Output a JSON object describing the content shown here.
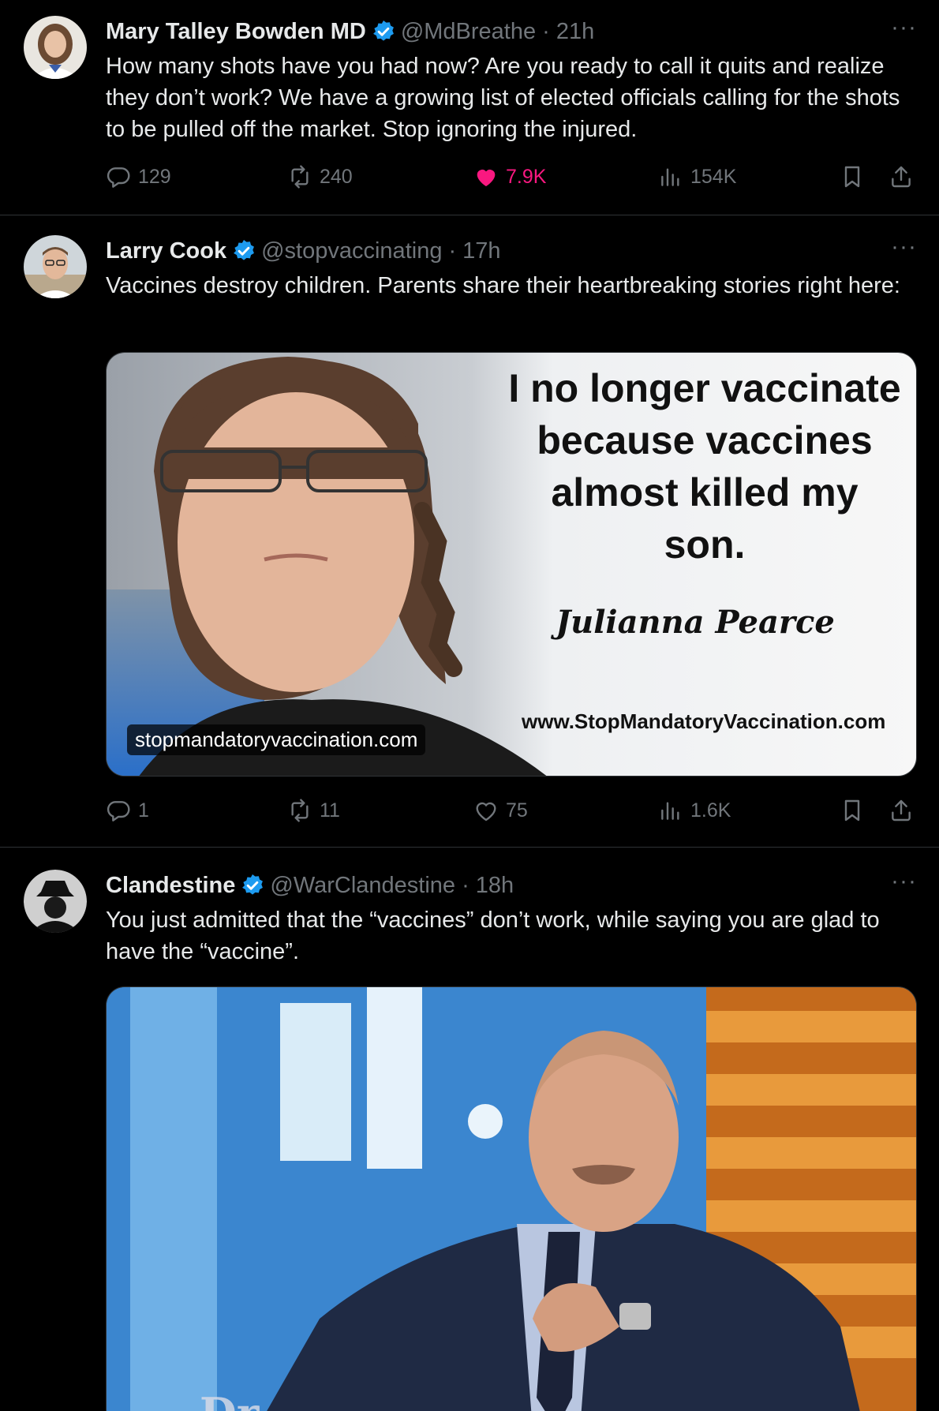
{
  "tweets": [
    {
      "name": "Mary Talley Bowden MD",
      "handle": "@MdBreathe",
      "time": "· 21h",
      "text": "How many shots have you had now?  Are you ready to call it quits and realize they don’t work?  We have a growing list of elected officials calling for the shots to be pulled off the market.  Stop ignoring the injured.",
      "replies": "129",
      "reposts": "240",
      "likes": "7.9K",
      "views": "154K",
      "liked": true
    },
    {
      "name": "Larry Cook",
      "handle": "@stopvaccinating",
      "time": "· 17h",
      "text": "Vaccines destroy children. Parents share their heartbreaking stories right here:",
      "replies": "1",
      "reposts": "11",
      "likes": "75",
      "views": "1.6K",
      "liked": false,
      "card": {
        "quote": "I no longer vaccinate because vaccines almost killed my son.",
        "author": "Julianna Pearce",
        "url": "www.StopMandatoryVaccination.com",
        "link_domain": "stopmandatoryvaccination.com"
      }
    },
    {
      "name": "Clandestine",
      "handle": "@WarClandestine",
      "time": "· 18h",
      "text": "You just admitted that the “vaccines” don’t work, while saying you are glad to have the “vaccine”.",
      "gif_logo": "Dr."
    }
  ],
  "icons": {
    "more": "more-icon",
    "reply": "reply-icon",
    "repost": "repost-icon",
    "like": "heart-icon",
    "views": "views-icon",
    "bookmark": "bookmark-icon",
    "share": "share-icon",
    "verified": "verified-badge-icon"
  },
  "colors": {
    "background": "#000000",
    "text": "#e7e9ea",
    "muted": "#71767b",
    "like_active": "#f91880",
    "verified": "#1d9bf0"
  }
}
